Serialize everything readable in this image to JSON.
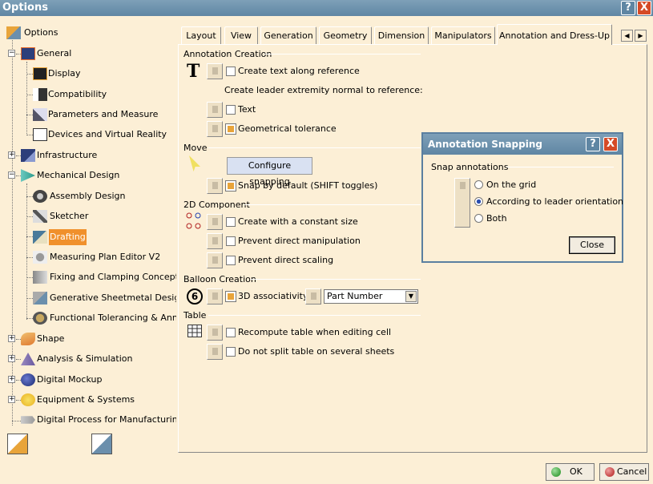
{
  "window": {
    "title": "Options",
    "help": "?",
    "close": "X"
  },
  "tree": [
    {
      "label": "Options",
      "icon": "options-root-icon"
    },
    {
      "label": "General",
      "icon": "general-icon"
    },
    {
      "label": "Display",
      "icon": "display-icon"
    },
    {
      "label": "Compatibility",
      "icon": "compatibility-icon"
    },
    {
      "label": "Parameters and Measure",
      "icon": "parameters-icon"
    },
    {
      "label": "Devices and Virtual Reality",
      "icon": "devices-icon"
    },
    {
      "label": "Infrastructure",
      "icon": "infrastructure-icon"
    },
    {
      "label": "Mechanical Design",
      "icon": "mechanical-design-icon"
    },
    {
      "label": "Assembly Design",
      "icon": "assembly-icon"
    },
    {
      "label": "Sketcher",
      "icon": "sketcher-icon"
    },
    {
      "label": "Drafting",
      "icon": "drafting-icon",
      "selected": true
    },
    {
      "label": "Measuring Plan Editor V2",
      "icon": "measuring-icon"
    },
    {
      "label": "Fixing and Clamping Concept",
      "icon": "fixing-icon"
    },
    {
      "label": "Generative Sheetmetal Design",
      "icon": "sheetmetal-icon"
    },
    {
      "label": "Functional Tolerancing & Annota",
      "icon": "tolerancing-icon"
    },
    {
      "label": "Shape",
      "icon": "shape-icon"
    },
    {
      "label": "Analysis & Simulation",
      "icon": "analysis-icon"
    },
    {
      "label": "Digital Mockup",
      "icon": "mockup-icon"
    },
    {
      "label": "Equipment & Systems",
      "icon": "equipment-icon"
    },
    {
      "label": "Digital Process for Manufacturing",
      "icon": "manufacturing-icon"
    }
  ],
  "tabs": [
    {
      "label": "Layout"
    },
    {
      "label": "View"
    },
    {
      "label": "Generation"
    },
    {
      "label": "Geometry"
    },
    {
      "label": "Dimension"
    },
    {
      "label": "Manipulators"
    },
    {
      "label": "Annotation and Dress-Up",
      "active": true
    }
  ],
  "tab_arrows": {
    "left": "◀",
    "right": "▶"
  },
  "annotation": {
    "section": "Annotation Creation",
    "text_icon": "T",
    "create_text_along": "Create text along reference",
    "leader_normal": "Create leader extremity normal to reference:",
    "text": "Text",
    "geo_tol": "Geometrical tolerance"
  },
  "move": {
    "section": "Move",
    "configure": "Configure snapping",
    "snap_default": "Snap by default (SHIFT toggles)"
  },
  "component": {
    "section": "2D Component",
    "constant_size": "Create with a constant size",
    "prevent_manip": "Prevent direct manipulation",
    "prevent_scaling": "Prevent direct scaling"
  },
  "balloon": {
    "section": "Balloon Creation",
    "icon_text": "6",
    "assoc": "3D associativity",
    "select_value": "Part Number",
    "select_arrow": "▼"
  },
  "table": {
    "section": "Table",
    "recompute": "Recompute table when editing cell",
    "no_split": "Do not split table on several sheets"
  },
  "checkboxes": {
    "create_text_along": false,
    "text": false,
    "geo_tol": true,
    "snap_default": true,
    "constant_size": false,
    "prevent_manip": false,
    "prevent_scaling": false,
    "assoc": true,
    "recompute": false,
    "no_split": false
  },
  "dialog": {
    "title": "Annotation Snapping",
    "help": "?",
    "close_x": "X",
    "group": "Snap annotations",
    "options": [
      "On the grid",
      "According to leader orientation",
      "Both"
    ],
    "selected": 1,
    "close": "Close"
  },
  "footer": {
    "ok": "OK",
    "cancel": "Cancel"
  },
  "colors": {
    "title_bar": "#6b8fac",
    "selection": "#f0902c",
    "panel": "#fcefd6"
  }
}
